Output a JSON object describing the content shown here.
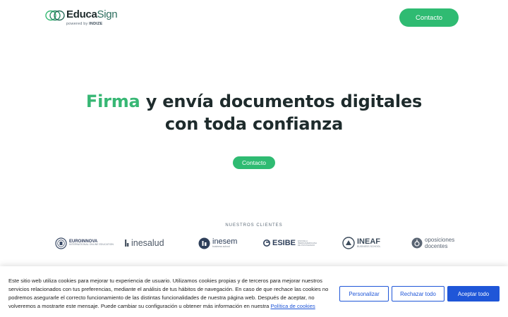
{
  "header": {
    "logo": {
      "word_bold": "Educa",
      "word_light": "Sign",
      "powered_prefix": "powered by",
      "powered_brand": "INDIZE"
    },
    "contact_label": "Contacto"
  },
  "hero": {
    "accent_word": "Firma",
    "line1_rest": " y envía documentos digitales",
    "line2": "con toda confianza",
    "cta_label": "Contacto"
  },
  "clients": {
    "title": "NUESTROS CLIENTES",
    "items": [
      {
        "name": "EUROINNOVA",
        "sub": "INTERNATIONAL ONLINE EDUCATION",
        "icon": "euroinnova-seal-icon"
      },
      {
        "name": "inesalud",
        "icon": "inesalud-mark-icon"
      },
      {
        "name": "inesem",
        "sub": "business school",
        "icon": "inesem-circle-icon"
      },
      {
        "name": "ESIBE",
        "sub": "ESCUELA IBEROAMERICANA DE POSTGRADO",
        "icon": "esibe-mark-icon"
      },
      {
        "name": "INEAF",
        "sub": "BUSINESS SCHOOL",
        "icon": "ineaf-circle-icon"
      },
      {
        "name_line1": "oposiciones",
        "name_line2": "docentes",
        "icon": "oposiciones-circle-icon"
      }
    ]
  },
  "cookie_banner": {
    "text": "Este sitio web utiliza cookies para mejorar tu experiencia de usuario. Utilizamos cookies propias y de terceros para mejorar nuestros servicios relacionados con tus preferencias, mediante el análisis de tus hábitos de navegación. En caso de que rechace las cookies no podremos asegurarle el correcto funcionamiento de las distintas funcionalidades de nuestra página web. Después de aceptar, no volveremos a mostrarte este mensaje. Puede cambiar su configuración u obtener más información en nuestra ",
    "link_label": "Política de cookies",
    "buttons": {
      "customize": "Personalizar",
      "reject": "Rechazar todo",
      "accept": "Aceptar todo"
    }
  },
  "colors": {
    "brand_green": "#2fbb72",
    "accent_green": "#37b774",
    "cookie_blue": "#1f56d8",
    "text_dark": "#1e2b2c"
  }
}
